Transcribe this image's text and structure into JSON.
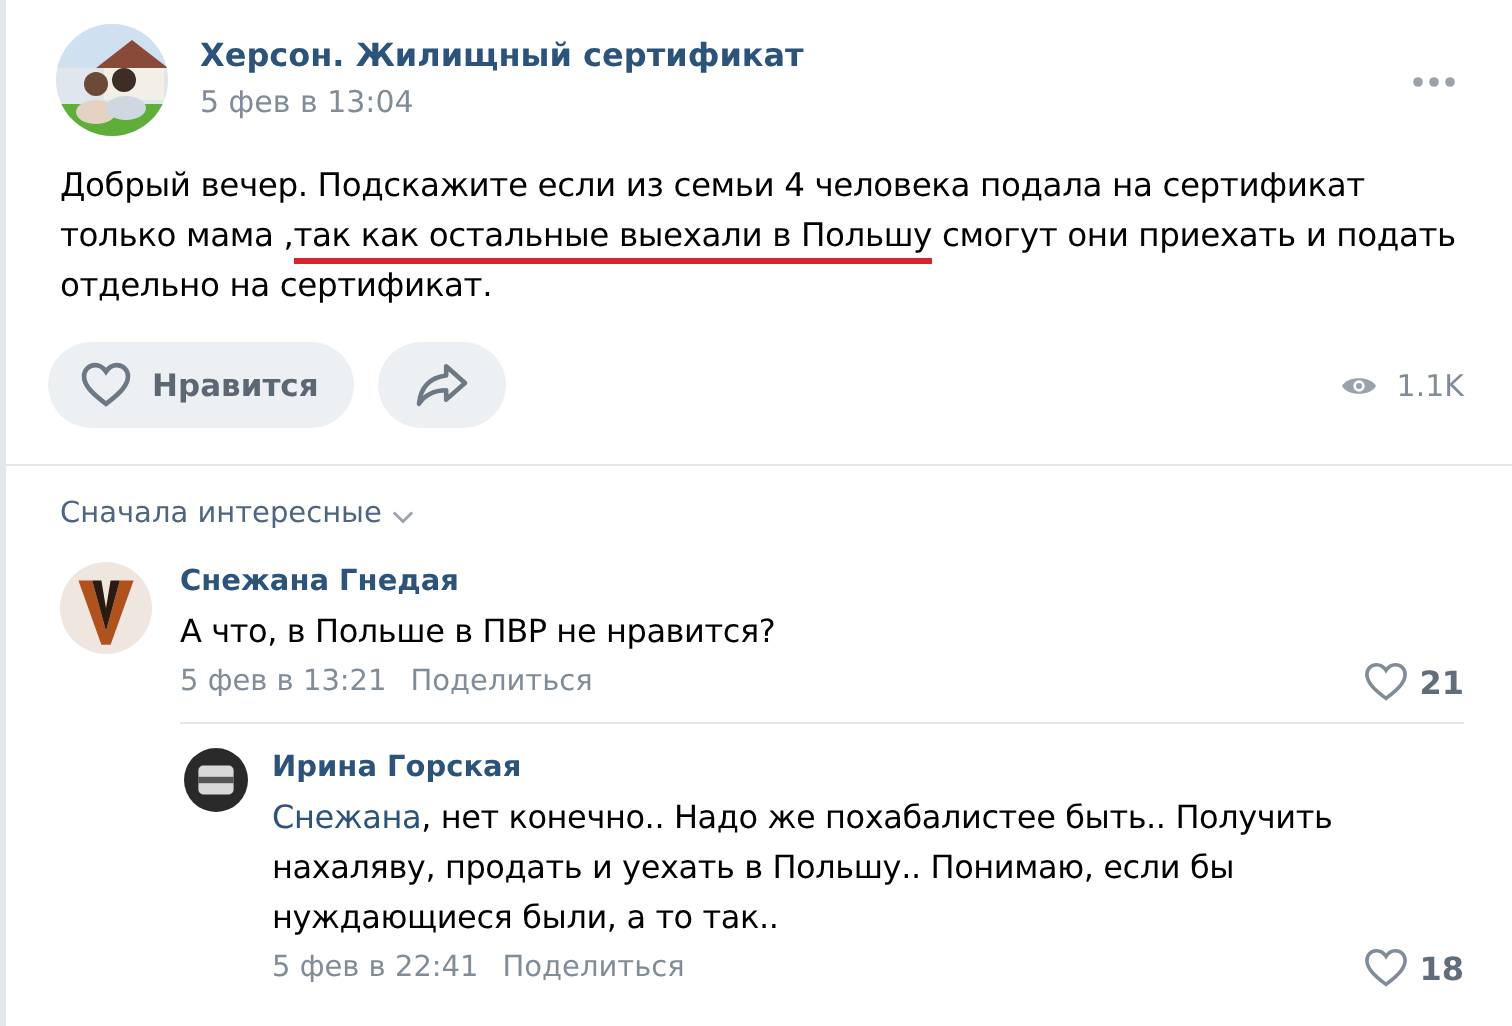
{
  "post": {
    "group": "Херсон. Жилищный сертификат",
    "date": "5 фев в 13:04",
    "text_before": "Добрый вечер. Подскажите если из семьи 4 человека подала на сертификат только мама ,",
    "text_underlined": "так как остальные выехали в Польшу",
    "text_after": " смогут они приехать и подать отдельно на сертификат.",
    "like_label": "Нравится",
    "views": "1.1K"
  },
  "sort": {
    "label": "Сначала интересные"
  },
  "comments": [
    {
      "author": "Снежана Гнедая",
      "text": "А что, в Польше в ПВР не нравится?",
      "date": "5 фев в 13:21",
      "share": "Поделиться",
      "likes": "21",
      "reply": false
    },
    {
      "author": "Ирина Горская",
      "mention": "Снежана",
      "text": ", нет конечно.. Надо же похабалистее быть.. Получить нахаляву, продать и уехать в Польшу.. Понимаю, если бы нуждающиеся были, а то так..",
      "date": "5 фев в 22:41",
      "share": "Поделиться",
      "likes": "18",
      "reply": true
    }
  ]
}
